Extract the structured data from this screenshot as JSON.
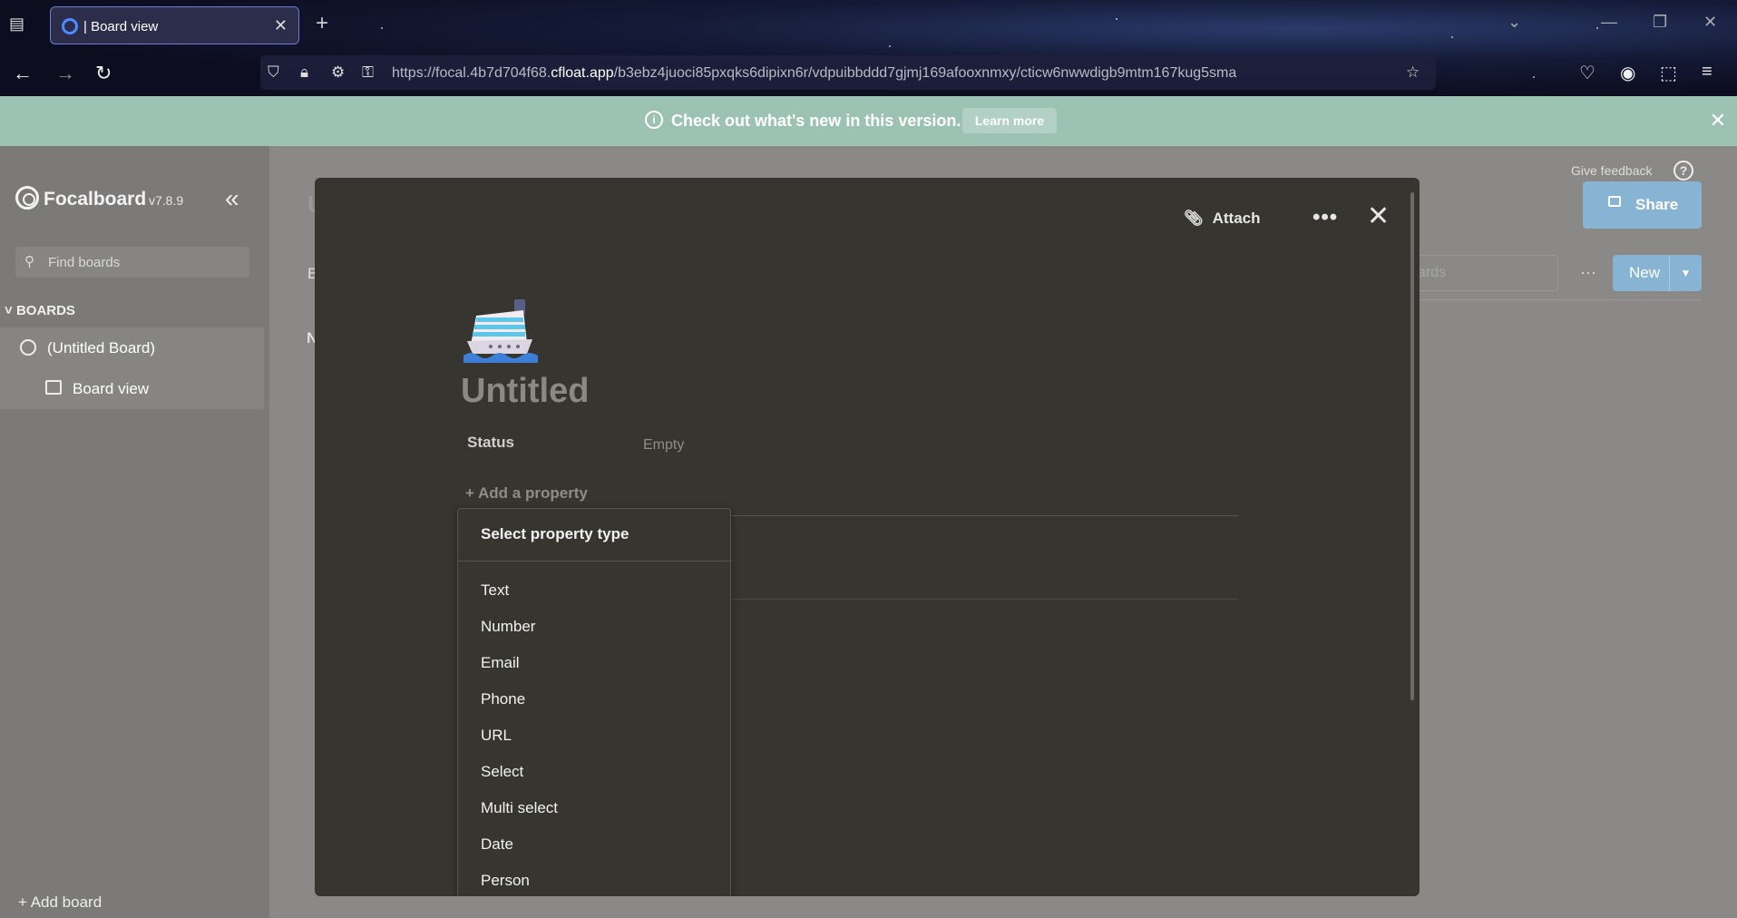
{
  "browser": {
    "tab_title": "| Board view",
    "url_prefix": "https://focal.4b7d704f68.",
    "url_domain": "cfloat.app",
    "url_path": "/b3ebz4juoci85pxqks6dipixn6r/vdpuibbddd7gjmj169afooxnmxy/cticw6nwwdigb9mtm167kug5sma"
  },
  "banner": {
    "message": "Check out what's new in this version.",
    "learn_more": "Learn more"
  },
  "sidebar": {
    "brand": "Focalboard",
    "version": "v7.8.9",
    "search_placeholder": "Find boards",
    "boards_header": "BOARDS",
    "board_name": "(Untitled Board)",
    "view_name": "Board view",
    "add_board": "+ Add board"
  },
  "header": {
    "give_feedback": "Give feedback",
    "share": "Share",
    "search_fragment": "ards",
    "new": "New",
    "more": "···"
  },
  "background_fragments": {
    "title_fragment": "U",
    "view_fragment": "B",
    "group_fragment": "N"
  },
  "card": {
    "attach": "Attach",
    "title": "Untitled",
    "status_label": "Status",
    "status_value": "Empty",
    "add_property": "+ Add a property"
  },
  "menu": {
    "header": "Select property type",
    "items": [
      "Text",
      "Number",
      "Email",
      "Phone",
      "URL",
      "Select",
      "Multi select",
      "Date",
      "Person"
    ]
  }
}
